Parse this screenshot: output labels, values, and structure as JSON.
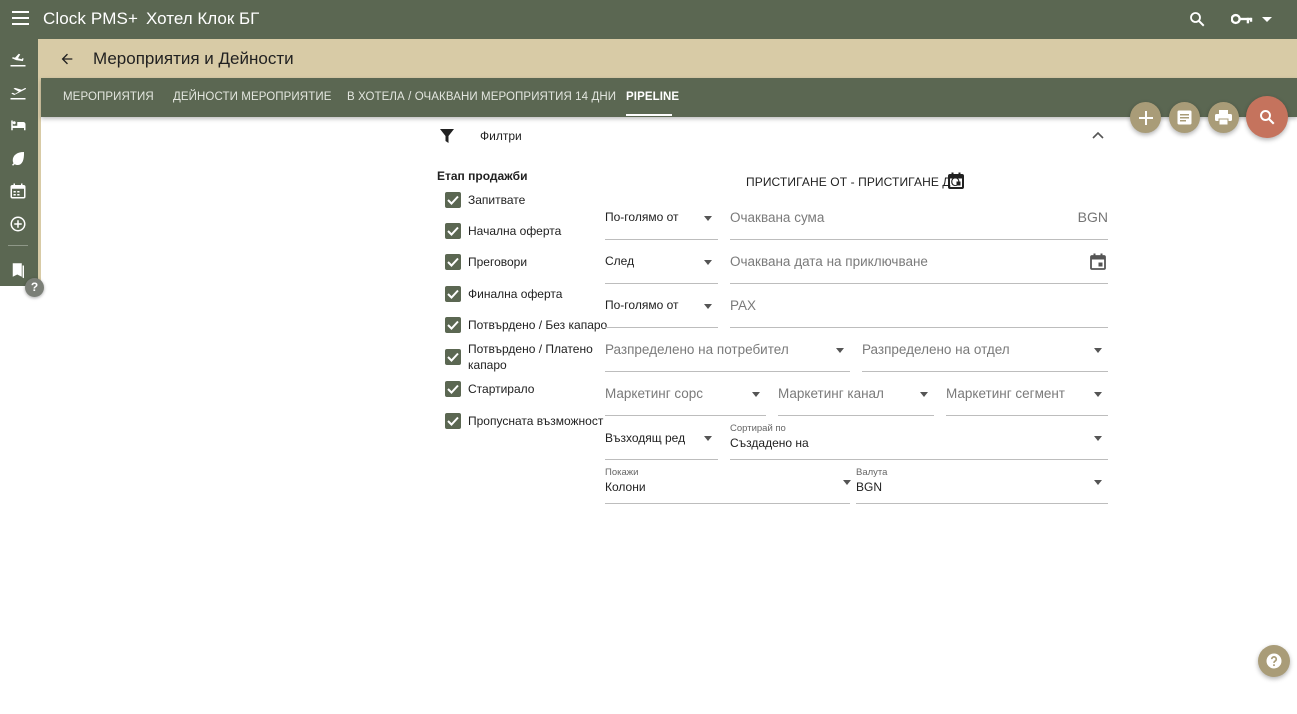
{
  "app": {
    "title": "Clock PMS+",
    "hotel": "Хотел Клок БГ"
  },
  "header": {
    "title": "Мероприятия и Дейности"
  },
  "tabs": [
    {
      "label": "МЕРОПРИЯТИЯ",
      "active": false
    },
    {
      "label": "ДЕЙНОСТИ МЕРОПРИЯТИЕ",
      "active": false
    },
    {
      "label": "В ХОТЕЛА / ОЧАКВАНИ МЕРОПРИЯТИЯ 14 ДНИ",
      "active": false
    },
    {
      "label": "PIPELINE",
      "active": true
    }
  ],
  "filters": {
    "label": "Филтри",
    "sales_stage": {
      "title": "Етап продажби",
      "options": [
        {
          "label": "Запитвате",
          "checked": true
        },
        {
          "label": "Начална оферта",
          "checked": true
        },
        {
          "label": "Преговори",
          "checked": true
        },
        {
          "label": "Финална оферта",
          "checked": true
        },
        {
          "label": "Потвърдено / Без капаро",
          "checked": true
        },
        {
          "label": "Потвърдено / Платено капаро",
          "checked": true
        },
        {
          "label": "Стартирало",
          "checked": true
        },
        {
          "label": "Пропусната възможност",
          "checked": true
        }
      ]
    },
    "date_range": "ПРИСТИГАНЕ ОТ - ПРИСТИГАНЕ ДО",
    "amount": {
      "operator": "По-голямо от",
      "placeholder": "Очаквана сума",
      "currency_suffix": "BGN"
    },
    "close_date": {
      "operator": "След",
      "placeholder": "Очаквана дата на приключване"
    },
    "pax": {
      "operator": "По-голямо от",
      "placeholder": "PAX"
    },
    "assigned_user": {
      "placeholder": "Разпределено на потребител"
    },
    "assigned_department": {
      "placeholder": "Разпределено на отдел"
    },
    "marketing_source": {
      "placeholder": "Маркетинг сорс"
    },
    "marketing_channel": {
      "placeholder": "Маркетинг канал"
    },
    "marketing_segment": {
      "placeholder": "Маркетинг сегмент"
    },
    "sort_order": {
      "value": "Възходящ ред"
    },
    "sort_by": {
      "label": "Сортирай по",
      "value": "Създадено на"
    },
    "show": {
      "label": "Покажи",
      "value": "Колони"
    },
    "currency": {
      "label": "Валута",
      "value": "BGN"
    }
  },
  "icons": {
    "rail": [
      "arrivals-icon",
      "departures-icon",
      "bed-icon",
      "leaf-icon",
      "calendar-icon",
      "add-circle-icon",
      "bookmarks-icon"
    ],
    "fabs": [
      "add-icon",
      "report-icon",
      "print-icon",
      "search-icon"
    ]
  },
  "colors": {
    "primary": "#5b6752",
    "header_bg": "#d8cba6",
    "fab": "#a99c78",
    "fab_accent": "#c5735d"
  }
}
